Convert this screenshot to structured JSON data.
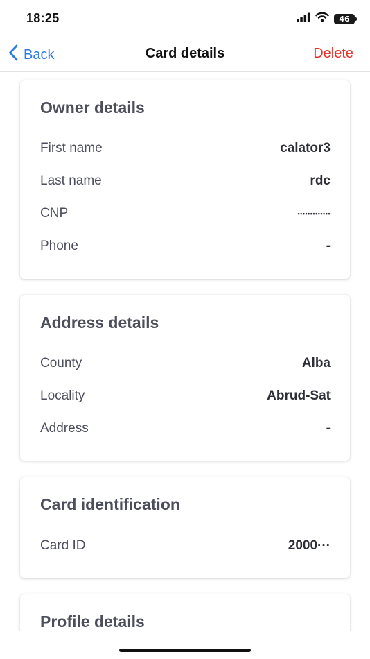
{
  "status": {
    "time": "18:25",
    "battery": "46",
    "icons": [
      "cellular-signal-icon",
      "wifi-icon",
      "battery-icon"
    ]
  },
  "nav": {
    "back_label": "Back",
    "title": "Card details",
    "delete_label": "Delete",
    "accent_color": "#2a7be4",
    "destructive_color": "#e5332a"
  },
  "owner": {
    "title": "Owner details",
    "rows": [
      {
        "label": "First name",
        "value": "calator3"
      },
      {
        "label": "Last name",
        "value": "rdc"
      },
      {
        "label": "CNP",
        "value": "•••••••••••••"
      },
      {
        "label": "Phone",
        "value": "-"
      }
    ]
  },
  "address": {
    "title": "Address details",
    "rows": [
      {
        "label": "County",
        "value": "Alba"
      },
      {
        "label": "Locality",
        "value": "Abrud-Sat"
      },
      {
        "label": "Address",
        "value": "-"
      }
    ]
  },
  "card_identification": {
    "title": "Card identification",
    "rows": [
      {
        "label": "Card ID",
        "value": "2000···"
      }
    ]
  },
  "profile": {
    "title": "Profile details"
  }
}
